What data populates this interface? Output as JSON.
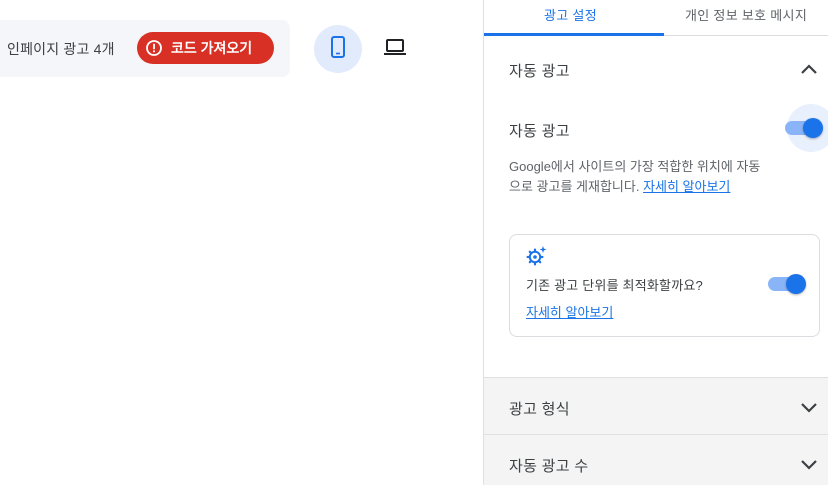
{
  "toolbar": {
    "page_ad_count": "인페이지 광고 4개",
    "get_code_label": "코드 가져오기"
  },
  "tabs": [
    {
      "label": "광고 설정"
    },
    {
      "label": "개인 정보 보호 메시지"
    }
  ],
  "auto_ads": {
    "section_title": "자동 광고",
    "toggle_label": "자동 광고",
    "toggle_on": true,
    "description": "Google에서 사이트의 가장 적합한 위치에 자동으로 광고를 게재합니다.",
    "learn_more": "자세히 알아보기",
    "optimize_card": {
      "text": "기존 광고 단위를 최적화할까요?",
      "toggle_on": true,
      "learn_more": "자세히 알아보기"
    }
  },
  "sections": [
    {
      "title": "광고 형식"
    },
    {
      "title": "자동 광고 수"
    }
  ],
  "colors": {
    "accent": "#1a73e8",
    "error": "#d93025"
  }
}
